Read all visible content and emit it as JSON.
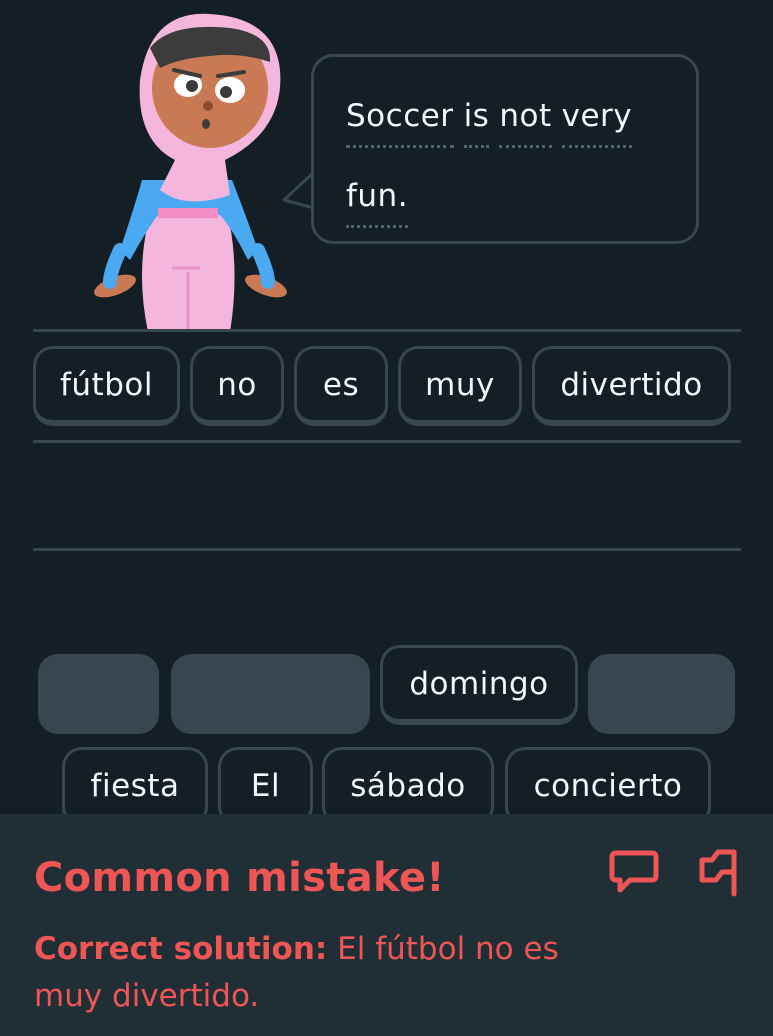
{
  "prompt": {
    "line1": [
      "Soccer",
      "is",
      "not",
      "very"
    ],
    "line2": [
      "fun."
    ]
  },
  "answer_chips": [
    "fútbol",
    "no",
    "es",
    "muy",
    "divertido"
  ],
  "bank_row1": {
    "empty_slots": 3,
    "word": "domingo"
  },
  "bank_row2": [
    "fiesta",
    "El",
    "sábado",
    "concierto"
  ],
  "feedback": {
    "title": "Common mistake!",
    "solution_label": "Correct solution:",
    "solution_text": " El fútbol no es muy divertido.",
    "report_icon": "comment-icon",
    "flag_icon": "flag-icon"
  },
  "colors": {
    "background": "#131f24",
    "panel": "#202f36",
    "border": "#37464f",
    "error": "#ee5555",
    "text": "#f1f7fb"
  }
}
